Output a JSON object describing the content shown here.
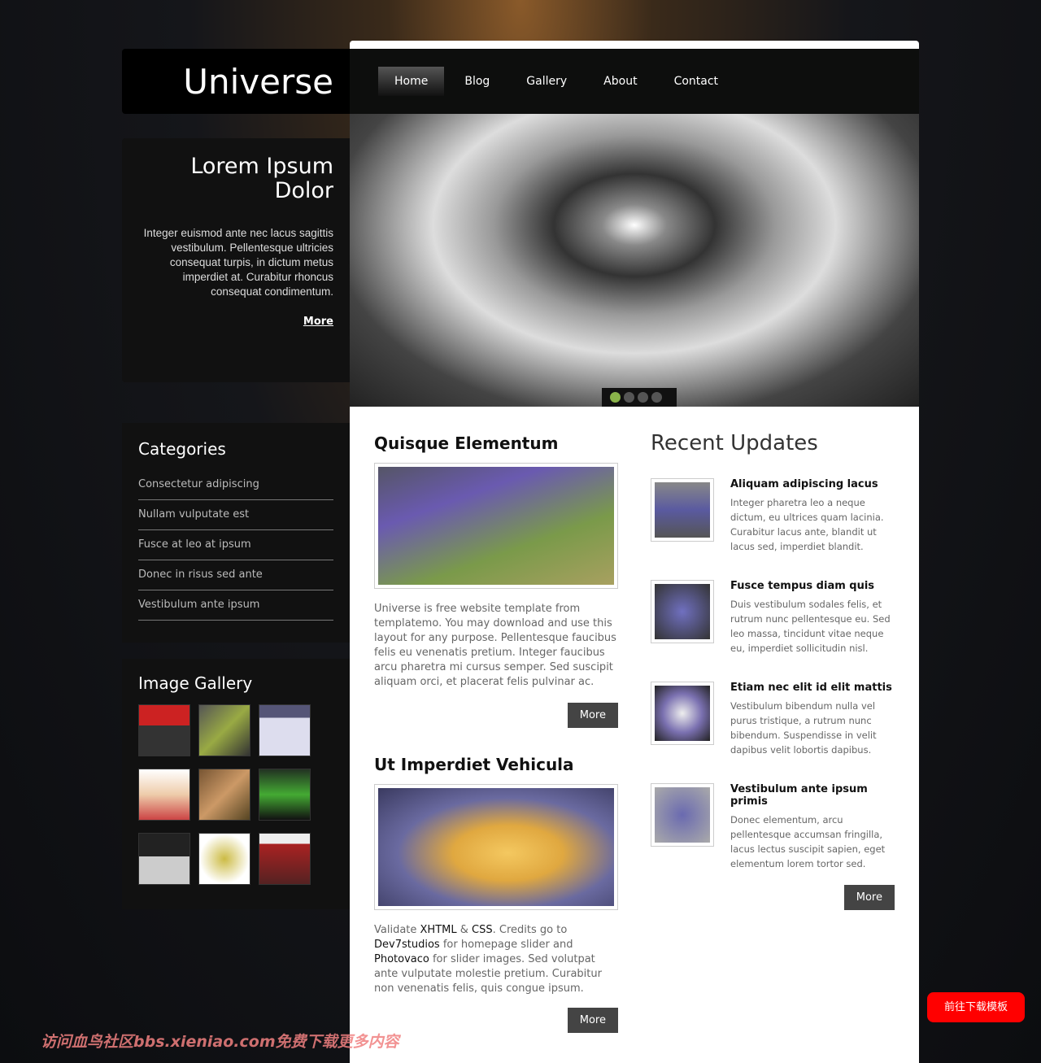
{
  "site": {
    "title": "Universe"
  },
  "nav": [
    {
      "label": "Home",
      "active": true
    },
    {
      "label": "Blog"
    },
    {
      "label": "Gallery"
    },
    {
      "label": "About"
    },
    {
      "label": "Contact"
    }
  ],
  "intro": {
    "title": "Lorem Ipsum Dolor",
    "text": "Integer euismod ante nec lacus sagittis vestibulum. Pellentesque ultricies consequat turpis, in dictum metus imperdiet at. Curabitur rhoncus consequat condimentum.",
    "more": "More"
  },
  "slider": {
    "dots": 4,
    "active": 1
  },
  "categories": {
    "title": "Categories",
    "items": [
      "Consectetur adipiscing",
      "Nullam vulputate est",
      "Fusce at leo at ipsum",
      "Donec in risus sed ante",
      "Vestibulum ante ipsum"
    ]
  },
  "gallery": {
    "title": "Image Gallery",
    "count": 9
  },
  "post1": {
    "title": "Quisque Elementum",
    "text": "Universe is free website template from templatemo. You may download and use this layout for any purpose. Pellentesque faucibus felis eu venenatis pretium. Integer faucibus arcu pharetra mi cursus semper. Sed suscipit aliquam orci, et placerat felis pulvinar ac.",
    "more": "More"
  },
  "post2": {
    "title": "Ut Imperdiet Vehicula",
    "t1": "Validate ",
    "l1": "XHTML",
    "t2": " & ",
    "l2": "CSS",
    "t3": ". Credits go to ",
    "l3": "Dev7studios",
    "t4": " for homepage slider and ",
    "l4": "Photovaco",
    "t5": " for slider images. Sed volutpat ante vulputate molestie pretium. Curabitur non venenatis felis, quis congue ipsum.",
    "more": "More"
  },
  "updates": {
    "title": "Recent Updates",
    "items": [
      {
        "title": "Aliquam adipiscing lacus",
        "text": "Integer pharetra leo a neque dictum, eu ultrices quam lacinia. Curabitur lacus ante, blandit ut lacus sed, imperdiet blandit."
      },
      {
        "title": "Fusce tempus diam quis",
        "text": "Duis vestibulum sodales felis, et rutrum nunc pellentesque eu. Sed leo massa, tincidunt vitae neque eu, imperdiet sollicitudin nisl."
      },
      {
        "title": "Etiam nec elit id elit mattis",
        "text": "Vestibulum bibendum nulla vel purus tristique, a rutrum nunc bibendum. Suspendisse in velit dapibus velit lobortis dapibus."
      },
      {
        "title": "Vestibulum ante ipsum primis",
        "text": "Donec elementum, arcu pellentesque accumsan fringilla, lacus lectus suscipit sapien, eget elementum lorem tortor sed."
      }
    ],
    "more": "More"
  },
  "download_button": "前往下载模板",
  "watermark": "访问血鸟社区bbs.xieniao.com免费下载更多内容"
}
